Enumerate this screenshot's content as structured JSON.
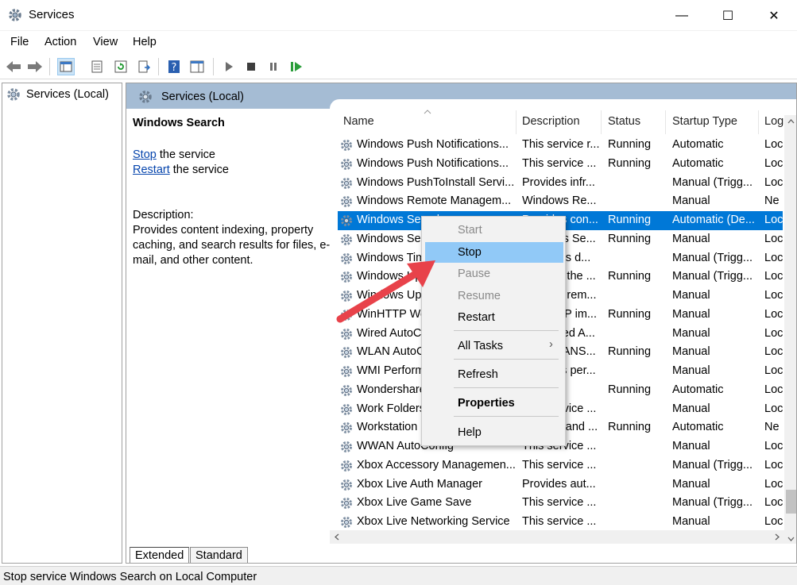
{
  "window": {
    "title": "Services",
    "minimize": "—",
    "maximize": "☐",
    "close": "✕"
  },
  "menu": [
    "File",
    "Action",
    "View",
    "Help"
  ],
  "tree": {
    "root_label": "Services (Local)"
  },
  "pane_header": {
    "title": "Services (Local)"
  },
  "selected_service": {
    "name": "Windows Search",
    "stop_link": "Stop",
    "stop_suffix": " the service",
    "restart_link": "Restart",
    "restart_suffix": " the service",
    "description_label": "Description:",
    "description_lines": [
      "Provides content indexing, property",
      "caching, and search results for files, e-",
      "mail, and other content."
    ]
  },
  "columns": [
    "Name",
    "Description",
    "Status",
    "Startup Type",
    "Log"
  ],
  "rows": [
    {
      "name": "Windows Push Notifications...",
      "desc": "This service r...",
      "status": "Running",
      "startup": "Automatic",
      "log": "Loc"
    },
    {
      "name": "Windows Push Notifications...",
      "desc": "This service ...",
      "status": "Running",
      "startup": "Automatic",
      "log": "Loc"
    },
    {
      "name": "Windows PushToInstall Servi...",
      "desc": "Provides infr...",
      "status": "",
      "startup": "Manual (Trigg...",
      "log": "Loc"
    },
    {
      "name": "Windows Remote Managem...",
      "desc": "Windows Re...",
      "status": "",
      "startup": "Manual",
      "log": "Ne"
    },
    {
      "name": "Windows Search",
      "desc": "Provides con...",
      "status": "Running",
      "startup": "Automatic (De...",
      "log": "Loc",
      "selected": true
    },
    {
      "name": "Windows Security Service",
      "desc": "Windows Se...",
      "status": "Running",
      "startup": "Manual",
      "log": "Loc"
    },
    {
      "name": "Windows Time",
      "desc": "Maintains d...",
      "status": "",
      "startup": "Manual (Trigg...",
      "log": "Loc"
    },
    {
      "name": "Windows Update",
      "desc": "Enables the ...",
      "status": "Running",
      "startup": "Manual (Trigg...",
      "log": "Loc"
    },
    {
      "name": "Windows Update Medic...",
      "desc": "Enables rem...",
      "status": "",
      "startup": "Manual",
      "log": "Loc"
    },
    {
      "name": "WinHTTP Web Proxy Aut...",
      "desc": "WinHTTP im...",
      "status": "Running",
      "startup": "Manual",
      "log": "Loc"
    },
    {
      "name": "Wired AutoConfig",
      "desc": "The Wired A...",
      "status": "",
      "startup": "Manual",
      "log": "Loc"
    },
    {
      "name": "WLAN AutoConfig",
      "desc": "The WLANS...",
      "status": "Running",
      "startup": "Manual",
      "log": "Loc"
    },
    {
      "name": "WMI Performance Adapter",
      "desc": "Provides per...",
      "status": "",
      "startup": "Manual",
      "log": "Loc"
    },
    {
      "name": "Wondershare Service",
      "desc": "",
      "status": "Running",
      "startup": "Automatic",
      "log": "Loc"
    },
    {
      "name": "Work Folders",
      "desc": "This service ...",
      "status": "",
      "startup": "Manual",
      "log": "Loc"
    },
    {
      "name": "Workstation",
      "desc": "Creates and ...",
      "status": "Running",
      "startup": "Automatic",
      "log": "Ne"
    },
    {
      "name": "WWAN AutoConfig",
      "desc": "This service ...",
      "status": "",
      "startup": "Manual",
      "log": "Loc"
    },
    {
      "name": "Xbox Accessory Managemen...",
      "desc": "This service ...",
      "status": "",
      "startup": "Manual (Trigg...",
      "log": "Loc"
    },
    {
      "name": "Xbox Live Auth Manager",
      "desc": "Provides aut...",
      "status": "",
      "startup": "Manual",
      "log": "Loc"
    },
    {
      "name": "Xbox Live Game Save",
      "desc": "This service ...",
      "status": "",
      "startup": "Manual (Trigg...",
      "log": "Loc"
    },
    {
      "name": "Xbox Live Networking Service",
      "desc": "This service ...",
      "status": "",
      "startup": "Manual",
      "log": "Loc"
    }
  ],
  "context_menu": {
    "start": "Start",
    "stop": "Stop",
    "pause": "Pause",
    "resume": "Resume",
    "restart": "Restart",
    "all_tasks": "All Tasks",
    "all_tasks_arrow": "›",
    "refresh": "Refresh",
    "properties": "Properties",
    "help": "Help"
  },
  "tabs": [
    "Extended",
    "Standard"
  ],
  "status_bar": "Stop service Windows Search on Local Computer",
  "colors": {
    "selection": "#0078d7",
    "menu_hover": "#91c9f7",
    "header": "#a5bcd4",
    "arrow": "#e8424a",
    "link": "#0645ad"
  }
}
